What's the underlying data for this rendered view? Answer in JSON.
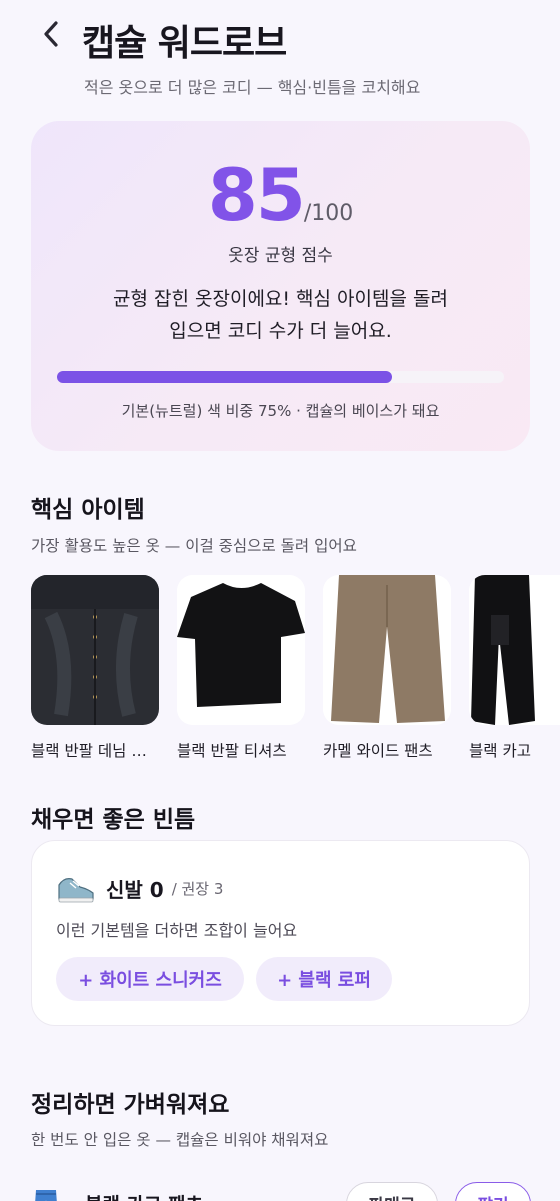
{
  "header": {
    "title": "캡슐 워드로브",
    "subtitle": "적은 옷으로 더 많은 코디 — 핵심·빈틈을 코치해요"
  },
  "score": {
    "value": "85",
    "max": "/100",
    "label": "옷장 균형 점수",
    "message_line1": "균형 잡힌 옷장이에요! 핵심 아이템을 돌려",
    "message_line2": "입으면 코디 수가 더 늘어요.",
    "progress_fraction": 0.75,
    "caption": "기본(뉴트럴) 색 비중 75% · 캡슐의 베이스가 돼요",
    "accent_color": "#7b52e6"
  },
  "core": {
    "title": "핵심 아이템",
    "subtitle": "가장 활용도 높은 옷 — 이걸 중심으로 돌려 입어요",
    "items": [
      {
        "label": "블랙 반팔 데님 셔츠",
        "image": "denim-shirt",
        "color": "#2b2d33"
      },
      {
        "label": "블랙 반팔 티셔츠",
        "image": "black-tshirt",
        "color": "#121214"
      },
      {
        "label": "카멜 와이드 팬츠",
        "image": "camel-pants",
        "color": "#8e7a65"
      },
      {
        "label": "블랙 카고",
        "image": "black-cargo",
        "color": "#111113"
      }
    ]
  },
  "gaps": {
    "title": "채우면 좋은 빈틈",
    "category": "신발 0",
    "recommended": "/ 권장 3",
    "description": "이런 기본템을 더하면 조합이 늘어요",
    "icon": "sneaker-icon",
    "chips": [
      "+ 화이트 스니커즈",
      "+ 블랙 로퍼"
    ]
  },
  "cleanup": {
    "title": "정리하면 가벼워져요",
    "subtitle": "한 번도 안 입은 옷 — 캡슐은 비워야 채워져요",
    "item_name": "블랙 카고 팬츠",
    "sell_label": "판매로",
    "donate_label": "팔기"
  }
}
